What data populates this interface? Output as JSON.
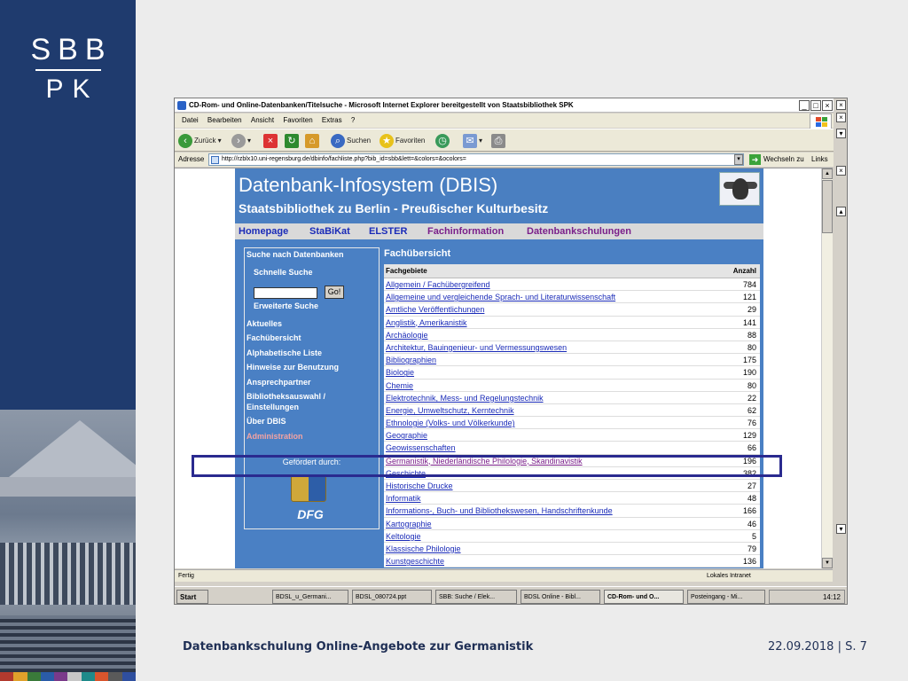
{
  "slide": {
    "logo_line1": "SBB",
    "logo_line2": "PK",
    "footer_title": "Datenbankschulung Online-Angebote zur Germanistik",
    "footer_date_page": "22.09.2018 | S. 7",
    "sidebar_color": "#1f3b6e"
  },
  "browser": {
    "title": "CD-Rom- und Online-Datenbanken/Titelsuche - Microsoft Internet Explorer bereitgestellt von Staatsbibliothek SPK",
    "menu": [
      "Datei",
      "Bearbeiten",
      "Ansicht",
      "Favoriten",
      "Extras",
      "?"
    ],
    "toolbar": {
      "back": "Zurück",
      "search": "Suchen",
      "favorites": "Favoriten"
    },
    "address_label": "Adresse",
    "address_value": "http://rzblx10.uni-regensburg.de/dbinfo/fachliste.php?bib_id=sbb&lett=&colors=&ocolors=",
    "go_label": "Wechseln zu",
    "links_label": "Links",
    "status_left": "Fertig",
    "status_right": "Lokales Intranet"
  },
  "dbis": {
    "title": "Datenbank-Infosystem (DBIS)",
    "subtitle": "Staatsbibliothek zu Berlin - Preußischer Kulturbesitz",
    "nav": [
      "Homepage",
      "StaBiKat",
      "ELSTER",
      "Fachinformation",
      "Datenbankschulungen"
    ],
    "left_nav": {
      "search_heading": "Suche nach Datenbanken",
      "quick_search": "Schnelle Suche",
      "go_button": "Go!",
      "advanced_search": "Erweiterte Suche",
      "items": [
        "Aktuelles",
        "Fachübersicht",
        "Alphabetische Liste",
        "Hinweise zur Benutzung",
        "Ansprechpartner",
        "Bibliotheksauswahl /",
        "Einstellungen",
        "Über DBIS"
      ],
      "admin": "Administration",
      "sponsor_label": "Gefördert durch:",
      "sponsor_logo": "DFG"
    },
    "overview_heading": "Fachübersicht",
    "table_headers": [
      "Fachgebiete",
      "Anzahl"
    ],
    "rows": [
      {
        "subject": "Allgemein / Fachübergreifend",
        "count": "784"
      },
      {
        "subject": "Allgemeine und vergleichende Sprach- und Literaturwissenschaft",
        "count": "121"
      },
      {
        "subject": "Amtliche Veröffentlichungen",
        "count": "29"
      },
      {
        "subject": "Anglistik, Amerikanistik",
        "count": "141"
      },
      {
        "subject": "Archäologie",
        "count": "88"
      },
      {
        "subject": "Architektur, Bauingenieur- und Vermessungswesen",
        "count": "80"
      },
      {
        "subject": "Bibliographien",
        "count": "175"
      },
      {
        "subject": "Biologie",
        "count": "190"
      },
      {
        "subject": "Chemie",
        "count": "80"
      },
      {
        "subject": "Elektrotechnik, Mess- und Regelungstechnik",
        "count": "22"
      },
      {
        "subject": "Energie, Umweltschutz, Kerntechnik",
        "count": "62"
      },
      {
        "subject": "Ethnologie (Volks- und Völkerkunde)",
        "count": "76"
      },
      {
        "subject": "Geographie",
        "count": "129"
      },
      {
        "subject": "Geowissenschaften",
        "count": "66"
      },
      {
        "subject": "Germanistik, Niederländische Philologie, Skandinavistik",
        "count": "196"
      },
      {
        "subject": "Geschichte",
        "count": "382"
      },
      {
        "subject": "Historische Drucke",
        "count": "27"
      },
      {
        "subject": "Informatik",
        "count": "48"
      },
      {
        "subject": "Informations-, Buch- und Bibliothekswesen, Handschriftenkunde",
        "count": "166"
      },
      {
        "subject": "Kartographie",
        "count": "46"
      },
      {
        "subject": "Keltologie",
        "count": "5"
      },
      {
        "subject": "Klassische Philologie",
        "count": "79"
      },
      {
        "subject": "Kunstgeschichte",
        "count": "136"
      }
    ]
  },
  "taskbar": {
    "start": "Start",
    "tasks": [
      "BDSL_u_Germani...",
      "BDSL_080724.ppt",
      "SBB: Suche / Elek...",
      "BDSL Online - Bibl...",
      "CD-Rom- und O...",
      "Posteingang - Mi..."
    ],
    "clock": "14:12"
  }
}
